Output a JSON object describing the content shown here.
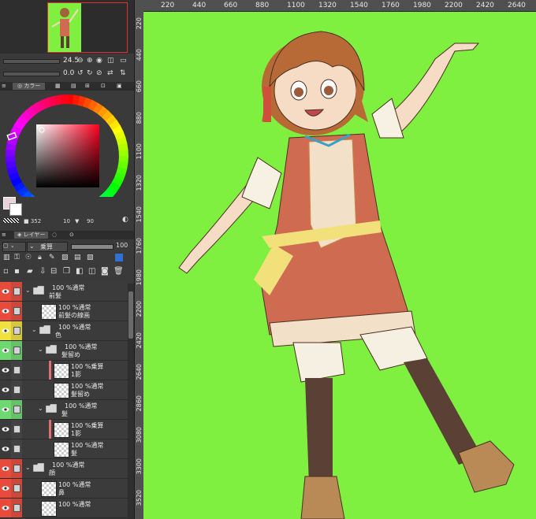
{
  "rulers": {
    "horizontal": [
      "220",
      "440",
      "660",
      "880",
      "1100",
      "1320",
      "1540",
      "1760",
      "1980",
      "2200",
      "2420",
      "2640"
    ],
    "vertical": [
      "220",
      "440",
      "660",
      "880",
      "1100",
      "1320",
      "1540",
      "1760",
      "1980",
      "2200",
      "2420",
      "2640",
      "2860",
      "3080",
      "3300",
      "3520"
    ]
  },
  "brush": {
    "size": "24.5",
    "angle": "0.0"
  },
  "tabs": {
    "color": "カラー",
    "layer": "レイヤー"
  },
  "color_info": {
    "h": "352",
    "s": "10",
    "v": "90"
  },
  "layer_panel": {
    "blend_mode": "乗算",
    "opacity": "100"
  },
  "layers": [
    {
      "line1": "100 %通常",
      "line2": "前髪",
      "type": "folder",
      "indent": 0,
      "eye": "#e84a3c"
    },
    {
      "line1": "100 %通常",
      "line2": "前髪の線画",
      "type": "layer",
      "indent": 1,
      "eye": "#e84a3c"
    },
    {
      "line1": "100 %通常",
      "line2": "色",
      "type": "folder",
      "indent": 1,
      "eye": "#f0e040"
    },
    {
      "line1": "100 %通常",
      "line2": "髪留め",
      "type": "folder",
      "indent": 2,
      "eye": "#70d870"
    },
    {
      "line1": "100 %乗算",
      "line2": "1影",
      "type": "layer",
      "indent": 3,
      "eye": "#3b3b3b"
    },
    {
      "line1": "100 %通常",
      "line2": "髪留め",
      "type": "layer",
      "indent": 3,
      "eye": "#3b3b3b"
    },
    {
      "line1": "100 %通常",
      "line2": "髪",
      "type": "folder",
      "indent": 2,
      "eye": "#70d870"
    },
    {
      "line1": "100 %乗算",
      "line2": "1影",
      "type": "layer",
      "indent": 3,
      "eye": "#3b3b3b"
    },
    {
      "line1": "100 %通常",
      "line2": "髪",
      "type": "layer",
      "indent": 3,
      "eye": "#3b3b3b"
    },
    {
      "line1": "100 %通常",
      "line2": "顔",
      "type": "folder",
      "indent": 0,
      "eye": "#e84a3c"
    },
    {
      "line1": "100 %通常",
      "line2": "鼻",
      "type": "layer",
      "indent": 1,
      "eye": "#e84a3c"
    },
    {
      "line1": "100 %通常",
      "line2": "",
      "type": "layer",
      "indent": 1,
      "eye": "#e84a3c"
    }
  ],
  "colors": {
    "canvas_bg": "#80f040",
    "main_color": "#e8d4d8",
    "sub_color": "#ffffff"
  }
}
